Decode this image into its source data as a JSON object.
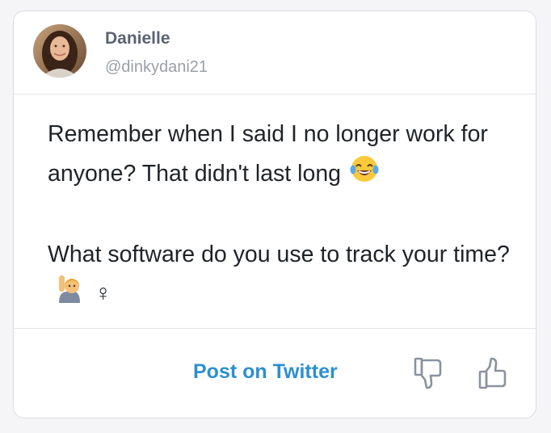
{
  "user": {
    "name": "Danielle",
    "handle": "@dinkydani21"
  },
  "post": {
    "line1": "Remember when I said I no longer work for anyone? That didn't last long",
    "line1_emoji": "face-with-tears-of-joy-emoji",
    "line2": "What software do you use to track your time?",
    "line2_emoji": "woman-raising-hand-emoji",
    "line2_suffix": "♀"
  },
  "footer": {
    "post_link": "Post on Twitter",
    "dislike_icon": "thumbs-down-icon",
    "like_icon": "thumbs-up-icon"
  },
  "colors": {
    "link": "#2d8fd0",
    "name": "#5b6372",
    "handle": "#9aa0aa",
    "text": "#1f2328",
    "icon": "#8a929e"
  }
}
